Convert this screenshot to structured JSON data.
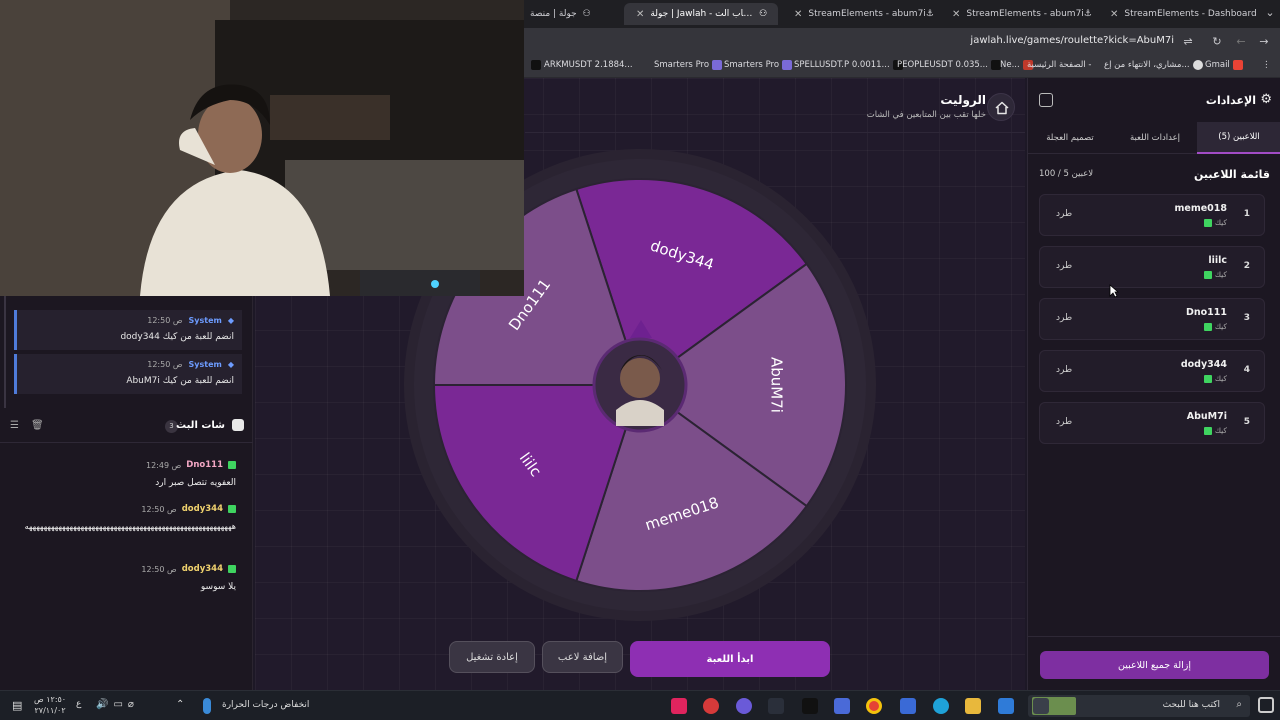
{
  "browser": {
    "tabs": [
      {
        "label": "جولة | منصة",
        "active": false
      },
      {
        "label": "جولة | Jawlah - منصة الألعاب الت",
        "active": true
      },
      {
        "label": "StreamElements - abum7i",
        "active": false
      },
      {
        "label": "StreamElements - abum7i",
        "active": false
      },
      {
        "label": "StreamElements - Dashboard",
        "active": false
      }
    ],
    "url": "jawlah.live/games/roulette?kick=AbuM7i",
    "bookmarks": [
      {
        "label": "ARKMUSDT 2.1884...",
        "color": "#222"
      },
      {
        "label": "Smarters Pro",
        "color": "#7a6ad8"
      },
      {
        "label": "Smarters Pro",
        "color": "#7a6ad8"
      },
      {
        "label": "SPELLUSDT.P 0.0011...",
        "color": "#222"
      },
      {
        "label": "PEOPLEUSDT 0.035...",
        "color": "#222"
      },
      {
        "label": "Ne...",
        "color": "#222"
      },
      {
        "label": "الصفحة الرئيسية -",
        "color": "#c0392b"
      },
      {
        "label": "مشاري، الانتهاء من إع...",
        "color": "#999"
      },
      {
        "label": "Gmail",
        "color": "#ea4335"
      }
    ]
  },
  "header": {
    "title": "الروليت",
    "subtitle": "خلها تقب بين المتابعين في الشات"
  },
  "wheel": {
    "segments": [
      "dody344",
      "AbuM7i",
      "meme018",
      "liilc",
      "Dno111"
    ]
  },
  "buttons": {
    "start": "ابدأ اللعبة",
    "add_player": "إضافة لاعب",
    "reset": "إعادة تشغيل"
  },
  "settings": {
    "title": "الإعدادات",
    "tabs": [
      "اللاعبين (5)",
      "إعدادات اللعبة",
      "تصميم العجلة"
    ],
    "players_heading": "قائمة اللاعبين",
    "players_count": "100 / 5 لاعبين",
    "kick_label": "طرد",
    "platform_label": "كيك",
    "players": [
      {
        "num": "1",
        "name": "meme018"
      },
      {
        "num": "2",
        "name": "liilc"
      },
      {
        "num": "3",
        "name": "Dno111"
      },
      {
        "num": "4",
        "name": "dody344"
      },
      {
        "num": "5",
        "name": "AbuM7i"
      }
    ],
    "remove_all": "إزالة جميع اللاعبين"
  },
  "chat": {
    "system_messages": [
      {
        "sender": "System",
        "time": "12:50 ص",
        "text": "dody344 انضم للعبة من كيك"
      },
      {
        "sender": "System",
        "time": "12:50 ص",
        "text": "AbuM7i انضم للعبة من كيك"
      }
    ],
    "title": "شات البث",
    "count": "3",
    "messages": [
      {
        "user": "Dno111",
        "time": "12:49 ص",
        "text": "العفويه تتصل صبر ارد",
        "color": "#f3a7c4"
      },
      {
        "user": "dody344",
        "time": "12:50 ص",
        "text": "ههههههههههههههههههههههههههههههههههههههههههههههههههههههههه",
        "color": "#f0d26e"
      },
      {
        "user": "dody344",
        "time": "12:50 ص",
        "text": "يلا سوسو",
        "color": "#f0d26e"
      }
    ]
  },
  "taskbar": {
    "search_placeholder": "اكتب هنا للبحث",
    "weather": "انخفاض درجات الحرارة",
    "time": "١٢:٥٠ ص",
    "date": "٢٧/١١/٠٢",
    "lang": "ع"
  }
}
